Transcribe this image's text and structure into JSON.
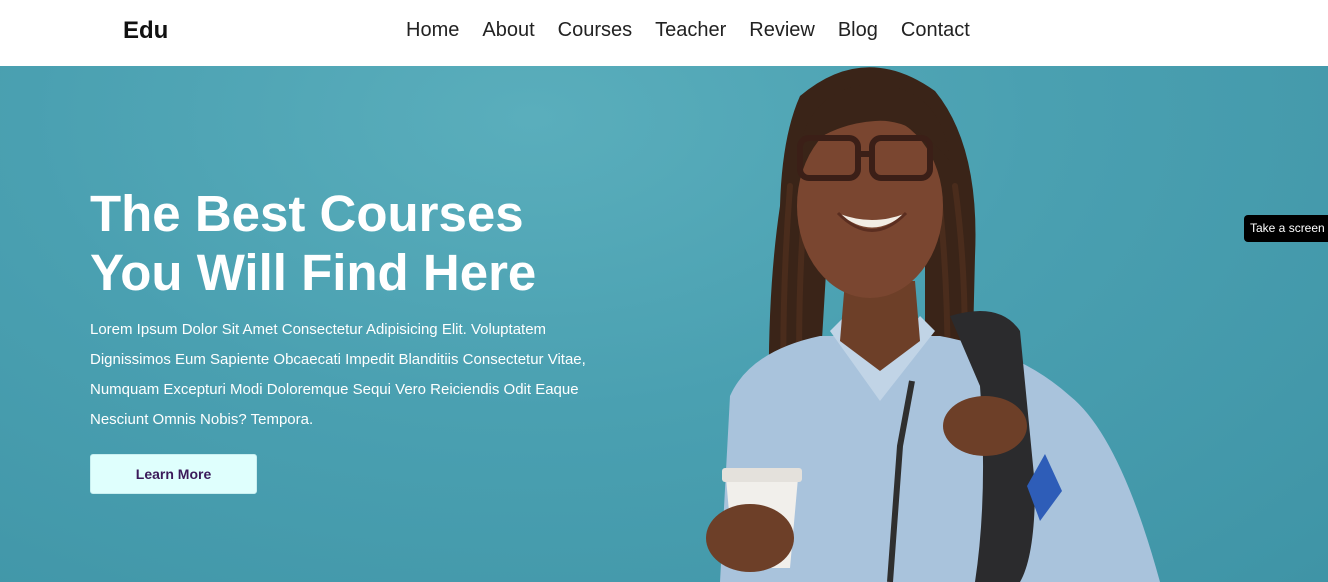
{
  "brand": {
    "logo": "Edu"
  },
  "nav": {
    "items": [
      {
        "label": "Home"
      },
      {
        "label": "About"
      },
      {
        "label": "Courses"
      },
      {
        "label": "Teacher"
      },
      {
        "label": "Review"
      },
      {
        "label": "Blog"
      },
      {
        "label": "Contact"
      }
    ]
  },
  "hero": {
    "title_line1": "The Best Courses",
    "title_line2": "You Will Find Here",
    "description": "Lorem Ipsum Dolor Sit Amet Consectetur Adipisicing Elit. Voluptatem Dignissimos Eum Sapiente Obcaecati Impedit Blanditiis Consectetur Vitae, Numquam Excepturi Modi Doloremque Sequi Vero Reiciendis Odit Eaque Nesciunt Omnis Nobis? Tempora.",
    "button_label": "Learn More"
  },
  "tooltip": {
    "text": "Take a screen"
  },
  "colors": {
    "hero_bg": "#4ea3b3",
    "button_bg": "#dffffd",
    "button_text": "#3b1a5a"
  }
}
